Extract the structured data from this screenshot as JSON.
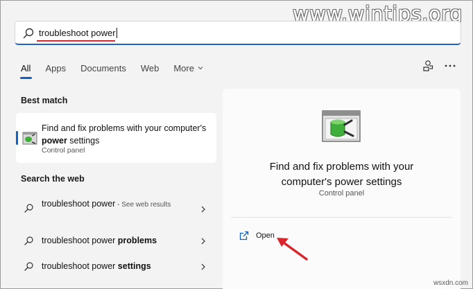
{
  "watermark": "www.wintips.org",
  "search": {
    "query": "troubleshoot power"
  },
  "tabs": [
    {
      "label": "All"
    },
    {
      "label": "Apps"
    },
    {
      "label": "Documents"
    },
    {
      "label": "Web"
    },
    {
      "label": "More"
    }
  ],
  "best_match": {
    "heading": "Best match",
    "title_part1": "Find and fix problems with your computer's ",
    "title_bold": "power",
    "title_part2": " settings",
    "subtitle": "Control panel"
  },
  "search_web": {
    "heading": "Search the web",
    "items": [
      {
        "text": "troubleshoot power",
        "bold": "",
        "hint": " - See web results"
      },
      {
        "text": "troubleshoot power ",
        "bold": "problems",
        "hint": ""
      },
      {
        "text": "troubleshoot power ",
        "bold": "settings",
        "hint": ""
      }
    ]
  },
  "detail": {
    "title": "Find and fix problems with your computer's power settings",
    "subtitle": "Control panel",
    "open_label": "Open"
  },
  "footer": "wsxdn.com",
  "colors": {
    "accent": "#0f61c4",
    "annotation": "#d9262c"
  }
}
